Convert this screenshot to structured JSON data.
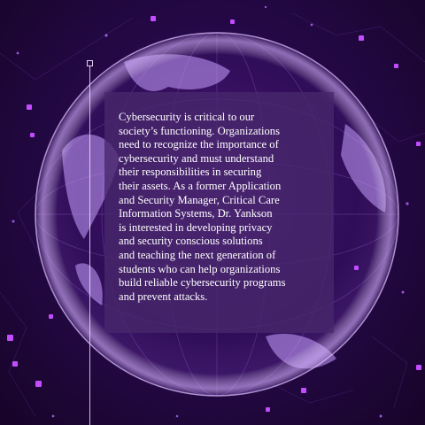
{
  "panel": {
    "text": "Cybersecurity is critical to our\nsociety’s functioning. Organizations\nneed to recognize the importance of\ncybersecurity and must understand\ntheir responsibilities in securing\ntheir assets. As a former Application\nand Security Manager, Critical Care\nInformation Systems, Dr. Yankson\nis interested in developing privacy\nand security conscious solutions\nand teaching the next generation of\nstudents who can help organizations\nbuild reliable cybersecurity programs\nand prevent attacks."
  },
  "colors": {
    "background": "#26094a",
    "globe_glow": "#b98cf0",
    "node_accent": "#c24dff",
    "panel_overlay": "#48286c",
    "text": "#ffffff"
  },
  "decor": {
    "globe": "globe-graphic",
    "network": "network-nodes"
  }
}
